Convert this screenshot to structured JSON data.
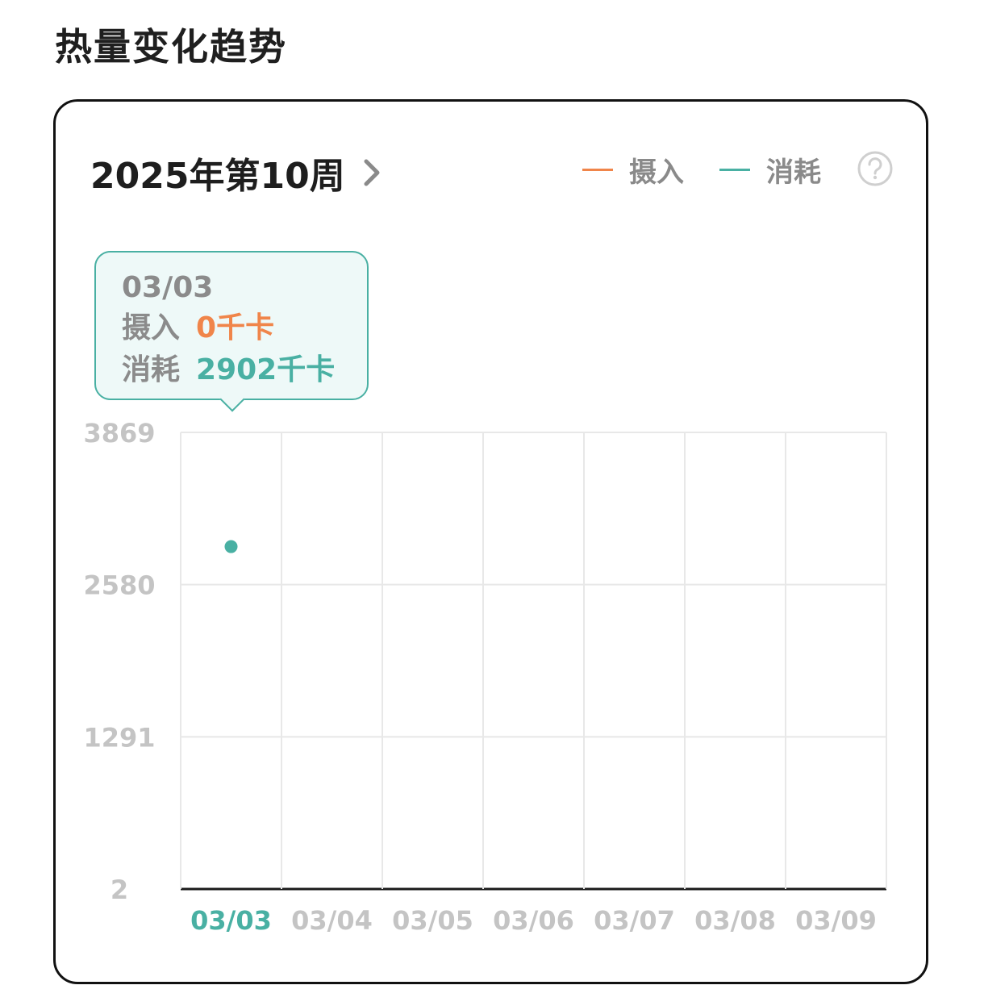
{
  "page": {
    "title": "热量变化趋势"
  },
  "header": {
    "week_label": "2025年第10周",
    "legend": [
      {
        "label": "摄入",
        "color": "#f0854a"
      },
      {
        "label": "消耗",
        "color": "#49b0a3"
      }
    ],
    "help_icon": "question-circle-icon"
  },
  "tooltip": {
    "date": "03/03",
    "intake_label": "摄入",
    "intake_value": "0千卡",
    "burn_label": "消耗",
    "burn_value": "2902千卡"
  },
  "chart_data": {
    "type": "scatter",
    "categories": [
      "03/03",
      "03/04",
      "03/05",
      "03/06",
      "03/07",
      "03/08",
      "03/09"
    ],
    "selected_category": "03/03",
    "y_ticks": [
      2,
      1291,
      2580,
      3869
    ],
    "ylim": [
      2,
      3869
    ],
    "series": [
      {
        "name": "摄入",
        "color": "#f0854a",
        "values": [
          0,
          null,
          null,
          null,
          null,
          null,
          null
        ]
      },
      {
        "name": "消耗",
        "color": "#49b0a3",
        "values": [
          2902,
          null,
          null,
          null,
          null,
          null,
          null
        ]
      }
    ],
    "grid": true
  }
}
